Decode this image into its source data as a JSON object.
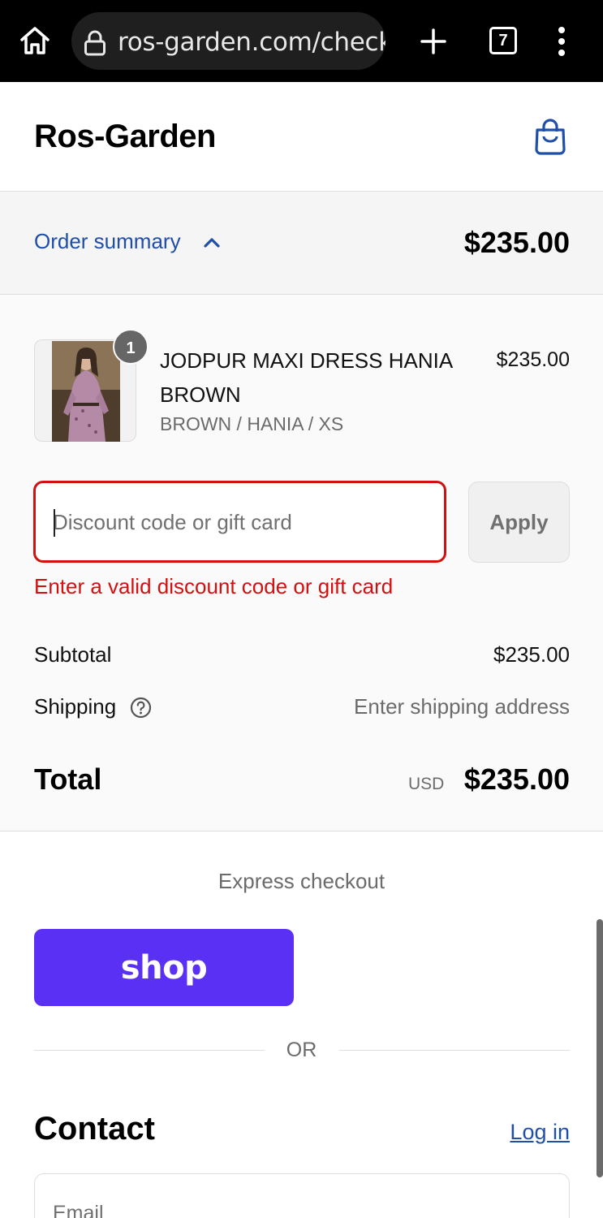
{
  "browser": {
    "url": "ros-garden.com/check",
    "tab_count": "7"
  },
  "header": {
    "brand": "Ros-Garden"
  },
  "order_summary": {
    "toggle_label": "Order summary",
    "total": "$235.00",
    "item": {
      "quantity": "1",
      "name": "JODPUR MAXI DRESS HANIA BROWN",
      "variant": "BROWN / HANIA / XS",
      "price": "$235.00"
    },
    "discount": {
      "placeholder": "Discount code or gift card",
      "apply_label": "Apply",
      "error": "Enter a valid discount code or gift card"
    },
    "subtotal_label": "Subtotal",
    "subtotal_value": "$235.00",
    "shipping_label": "Shipping",
    "shipping_value": "Enter shipping address",
    "total_label": "Total",
    "currency": "USD",
    "total_value": "$235.00"
  },
  "express": {
    "label": "Express checkout",
    "shop_label": "shop",
    "or_label": "OR"
  },
  "contact": {
    "heading": "Contact",
    "login_label": "Log in",
    "email_placeholder": "Email"
  },
  "colors": {
    "accent_blue": "#1f4fa8",
    "error_red": "#d40f0f",
    "shop_purple": "#5a31f4"
  }
}
